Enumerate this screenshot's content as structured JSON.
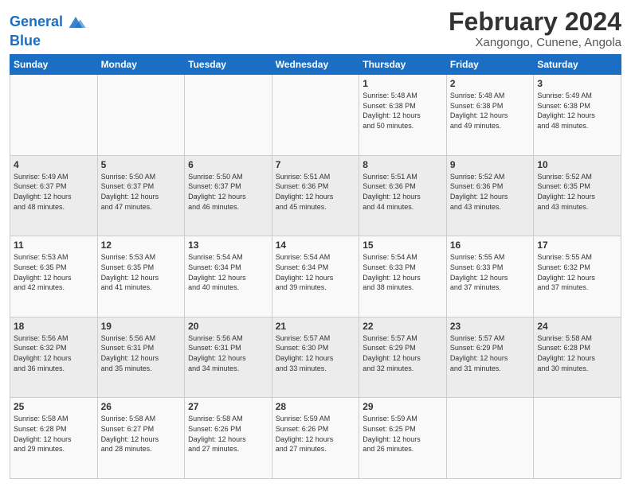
{
  "header": {
    "logo_line1": "General",
    "logo_line2": "Blue",
    "title": "February 2024",
    "subtitle": "Xangongo, Cunene, Angola"
  },
  "weekdays": [
    "Sunday",
    "Monday",
    "Tuesday",
    "Wednesday",
    "Thursday",
    "Friday",
    "Saturday"
  ],
  "rows": [
    [
      {
        "day": "",
        "info": ""
      },
      {
        "day": "",
        "info": ""
      },
      {
        "day": "",
        "info": ""
      },
      {
        "day": "",
        "info": ""
      },
      {
        "day": "1",
        "info": "Sunrise: 5:48 AM\nSunset: 6:38 PM\nDaylight: 12 hours\nand 50 minutes."
      },
      {
        "day": "2",
        "info": "Sunrise: 5:48 AM\nSunset: 6:38 PM\nDaylight: 12 hours\nand 49 minutes."
      },
      {
        "day": "3",
        "info": "Sunrise: 5:49 AM\nSunset: 6:38 PM\nDaylight: 12 hours\nand 48 minutes."
      }
    ],
    [
      {
        "day": "4",
        "info": "Sunrise: 5:49 AM\nSunset: 6:37 PM\nDaylight: 12 hours\nand 48 minutes."
      },
      {
        "day": "5",
        "info": "Sunrise: 5:50 AM\nSunset: 6:37 PM\nDaylight: 12 hours\nand 47 minutes."
      },
      {
        "day": "6",
        "info": "Sunrise: 5:50 AM\nSunset: 6:37 PM\nDaylight: 12 hours\nand 46 minutes."
      },
      {
        "day": "7",
        "info": "Sunrise: 5:51 AM\nSunset: 6:36 PM\nDaylight: 12 hours\nand 45 minutes."
      },
      {
        "day": "8",
        "info": "Sunrise: 5:51 AM\nSunset: 6:36 PM\nDaylight: 12 hours\nand 44 minutes."
      },
      {
        "day": "9",
        "info": "Sunrise: 5:52 AM\nSunset: 6:36 PM\nDaylight: 12 hours\nand 43 minutes."
      },
      {
        "day": "10",
        "info": "Sunrise: 5:52 AM\nSunset: 6:35 PM\nDaylight: 12 hours\nand 43 minutes."
      }
    ],
    [
      {
        "day": "11",
        "info": "Sunrise: 5:53 AM\nSunset: 6:35 PM\nDaylight: 12 hours\nand 42 minutes."
      },
      {
        "day": "12",
        "info": "Sunrise: 5:53 AM\nSunset: 6:35 PM\nDaylight: 12 hours\nand 41 minutes."
      },
      {
        "day": "13",
        "info": "Sunrise: 5:54 AM\nSunset: 6:34 PM\nDaylight: 12 hours\nand 40 minutes."
      },
      {
        "day": "14",
        "info": "Sunrise: 5:54 AM\nSunset: 6:34 PM\nDaylight: 12 hours\nand 39 minutes."
      },
      {
        "day": "15",
        "info": "Sunrise: 5:54 AM\nSunset: 6:33 PM\nDaylight: 12 hours\nand 38 minutes."
      },
      {
        "day": "16",
        "info": "Sunrise: 5:55 AM\nSunset: 6:33 PM\nDaylight: 12 hours\nand 37 minutes."
      },
      {
        "day": "17",
        "info": "Sunrise: 5:55 AM\nSunset: 6:32 PM\nDaylight: 12 hours\nand 37 minutes."
      }
    ],
    [
      {
        "day": "18",
        "info": "Sunrise: 5:56 AM\nSunset: 6:32 PM\nDaylight: 12 hours\nand 36 minutes."
      },
      {
        "day": "19",
        "info": "Sunrise: 5:56 AM\nSunset: 6:31 PM\nDaylight: 12 hours\nand 35 minutes."
      },
      {
        "day": "20",
        "info": "Sunrise: 5:56 AM\nSunset: 6:31 PM\nDaylight: 12 hours\nand 34 minutes."
      },
      {
        "day": "21",
        "info": "Sunrise: 5:57 AM\nSunset: 6:30 PM\nDaylight: 12 hours\nand 33 minutes."
      },
      {
        "day": "22",
        "info": "Sunrise: 5:57 AM\nSunset: 6:29 PM\nDaylight: 12 hours\nand 32 minutes."
      },
      {
        "day": "23",
        "info": "Sunrise: 5:57 AM\nSunset: 6:29 PM\nDaylight: 12 hours\nand 31 minutes."
      },
      {
        "day": "24",
        "info": "Sunrise: 5:58 AM\nSunset: 6:28 PM\nDaylight: 12 hours\nand 30 minutes."
      }
    ],
    [
      {
        "day": "25",
        "info": "Sunrise: 5:58 AM\nSunset: 6:28 PM\nDaylight: 12 hours\nand 29 minutes."
      },
      {
        "day": "26",
        "info": "Sunrise: 5:58 AM\nSunset: 6:27 PM\nDaylight: 12 hours\nand 28 minutes."
      },
      {
        "day": "27",
        "info": "Sunrise: 5:58 AM\nSunset: 6:26 PM\nDaylight: 12 hours\nand 27 minutes."
      },
      {
        "day": "28",
        "info": "Sunrise: 5:59 AM\nSunset: 6:26 PM\nDaylight: 12 hours\nand 27 minutes."
      },
      {
        "day": "29",
        "info": "Sunrise: 5:59 AM\nSunset: 6:25 PM\nDaylight: 12 hours\nand 26 minutes."
      },
      {
        "day": "",
        "info": ""
      },
      {
        "day": "",
        "info": ""
      }
    ]
  ]
}
